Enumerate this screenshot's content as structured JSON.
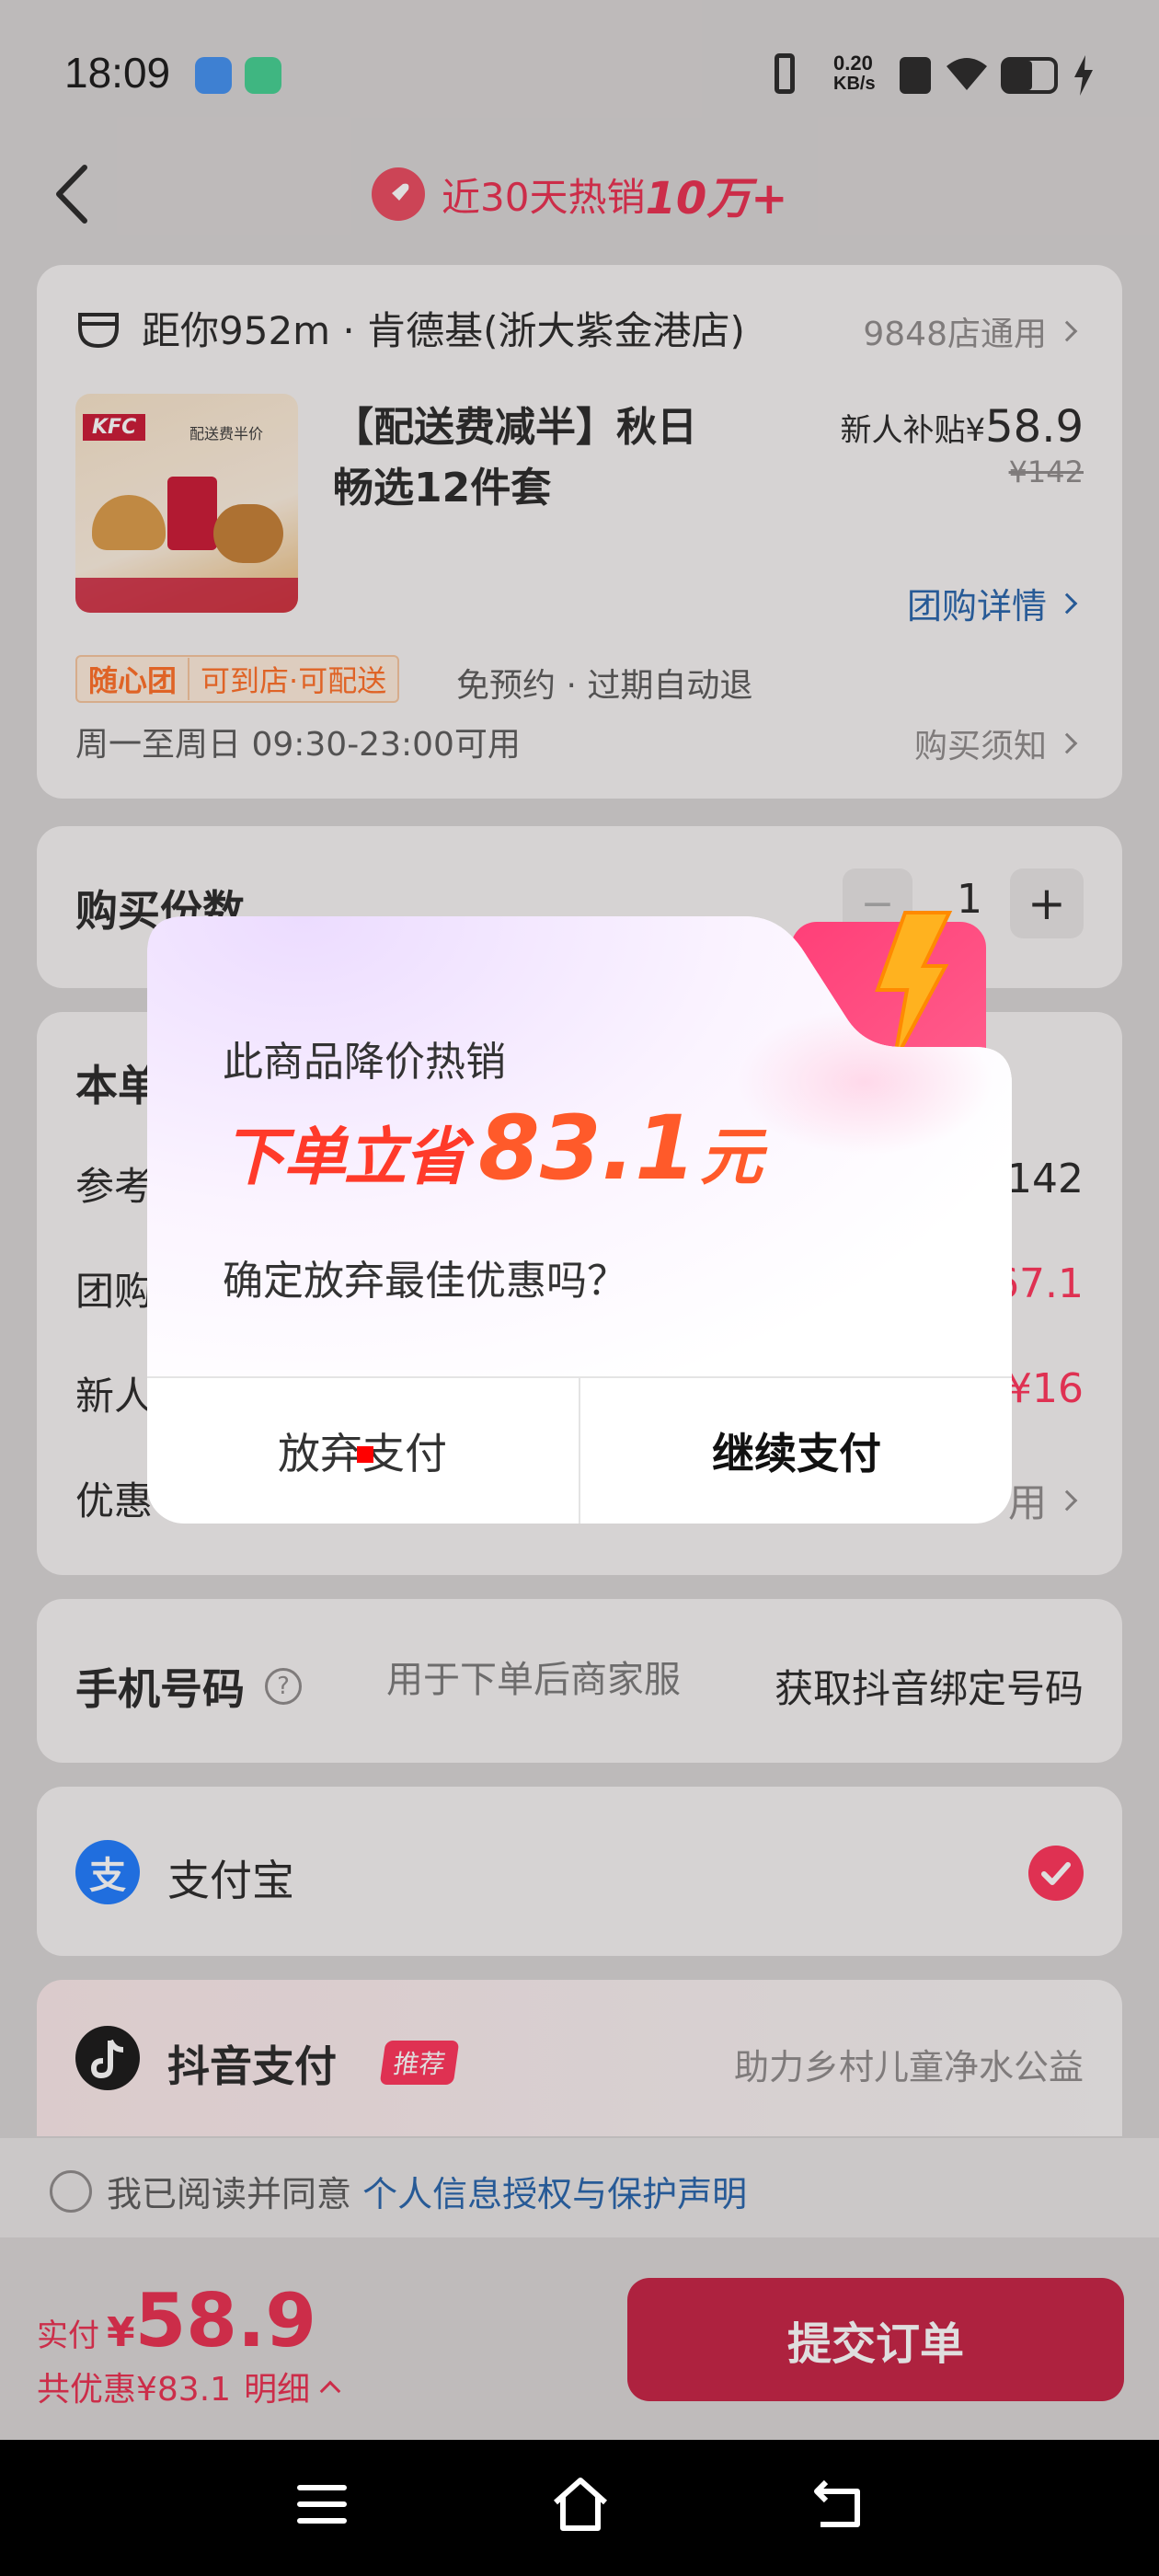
{
  "status_bar": {
    "time": "18:09",
    "net_speed_value": "0.20",
    "net_speed_unit": "KB/s"
  },
  "header": {
    "title_prefix": "近30天热销",
    "title_highlight": "10万+"
  },
  "store": {
    "distance_name": "距你952m · 肯德基(浙大紫金港店)",
    "stores_link": "9848店通用"
  },
  "product": {
    "image_brand": "KFC",
    "image_badge": "配送费半价",
    "title": "【配送费减半】秋日畅选12件套",
    "price_label": "新人补贴¥",
    "price": "58.9",
    "original_price": "¥142",
    "detail_link": "团购详情",
    "tag_brand": "随心团",
    "tag_text": "可到店·可配送",
    "policy": "免预约 · 过期自动退",
    "hours": "周一至周日 09:30-23:00可用",
    "notice_link": "购买须知"
  },
  "quantity": {
    "label": "购买份数",
    "value": "1",
    "minus": "−",
    "plus": "+"
  },
  "summary": {
    "title_partial": "本单",
    "rows": [
      {
        "label": "参考",
        "value": "142"
      },
      {
        "label": "团购",
        "value": "67.1"
      },
      {
        "label": "新人",
        "value": "¥16"
      },
      {
        "label": "优惠",
        "value": "用"
      }
    ]
  },
  "phone": {
    "label": "手机号码",
    "help_icon": "?",
    "placeholder": "用于下单后商家服",
    "bind_link": "获取抖音绑定号码"
  },
  "payment": {
    "alipay_label": "支付宝",
    "alipay_icon": "支",
    "douyin_label": "抖音支付",
    "douyin_badge": "推荐",
    "douyin_charity": "助力乡村儿童净水公益"
  },
  "agreement": {
    "prefix": "我已阅读并同意 ",
    "link": "个人信息授权与保护声明"
  },
  "footer": {
    "pay_label": "实付",
    "currency": "¥",
    "amount": "58.9",
    "discount": "共优惠¥83.1",
    "detail": "明细",
    "submit": "提交订单"
  },
  "dialog": {
    "subtitle": "此商品降价热销",
    "save_prefix": "下单立省",
    "save_amount": "83.1",
    "save_unit": "元",
    "question": "确定放弃最佳优惠吗？",
    "cancel": "放弃支付",
    "confirm": "继续支付"
  },
  "colors": {
    "accent": "#ff2c55",
    "submit_bg": "#c41a3e",
    "link_blue": "#1f5ea8"
  }
}
